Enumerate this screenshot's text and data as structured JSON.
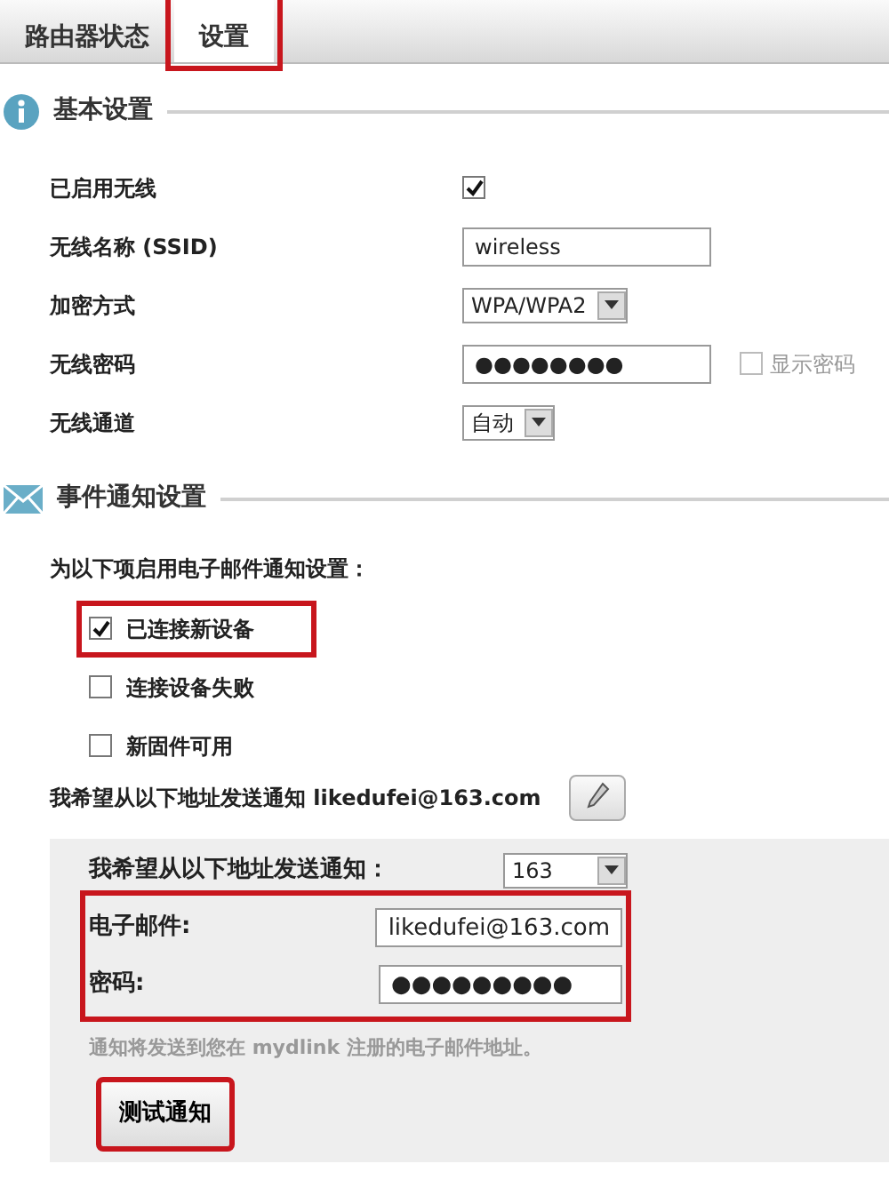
{
  "tabs": [
    {
      "label": "路由器状态",
      "selected": false,
      "highlighted": false
    },
    {
      "label": "设置",
      "selected": true,
      "highlighted": true
    }
  ],
  "basic_settings": {
    "title": "基本设置",
    "rows": [
      {
        "kind": "checkbox",
        "label": "已启用无线",
        "checked": true
      },
      {
        "kind": "text",
        "label": "无线名称 (SSID)",
        "value": "wireless"
      },
      {
        "kind": "select",
        "label": "加密方式",
        "value": "WPA/WPA2"
      },
      {
        "kind": "password",
        "label": "无线密码",
        "value": "●●●●●●●●",
        "show_label": "显示密码",
        "show_checked": false,
        "show_disabled": true
      },
      {
        "kind": "select",
        "label": "无线通道",
        "value": "自动"
      }
    ]
  },
  "event_notification": {
    "title": "事件通知设置",
    "intro": "为以下项启用电子邮件通知设置：",
    "events": [
      {
        "label": "已连接新设备",
        "checked": true,
        "highlighted": true
      },
      {
        "label": "连接设备失败",
        "checked": false,
        "highlighted": false
      },
      {
        "label": "新固件可用",
        "checked": false,
        "highlighted": false
      }
    ],
    "sender_line": "我希望从以下地址发送通知 likedufei@163.com",
    "panel": {
      "provider_label": "我希望从以下地址发送通知：",
      "provider": "163",
      "email_label": "电子邮件:",
      "email": "likedufei@163.com",
      "password_label": "密码:",
      "password": "●●●●●●●●●",
      "fields_highlighted": true,
      "note": "通知将发送到您在 mydlink 注册的电子邮件地址。",
      "test_button": "测试通知",
      "test_highlighted": true
    }
  }
}
